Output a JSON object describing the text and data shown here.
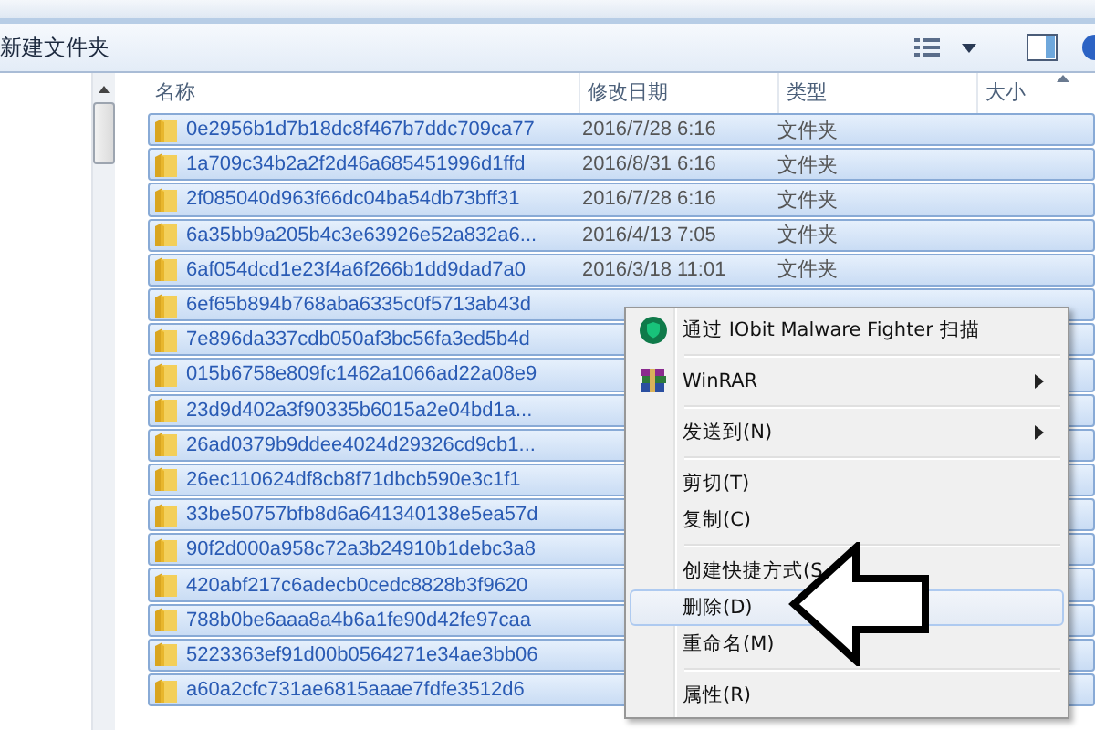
{
  "toolbar": {
    "new_folder": "新建文件夹"
  },
  "columns": [
    "名称",
    "修改日期",
    "类型",
    "大小"
  ],
  "rows": [
    {
      "name": "0e2956b1d7b18dc8f467b7ddc709ca77",
      "date": "2016/7/28 6:16",
      "type": "文件夹",
      "selected": true
    },
    {
      "name": "1a709c34b2a2f2d46a685451996d1ffd",
      "date": "2016/8/31 6:16",
      "type": "文件夹",
      "selected": true
    },
    {
      "name": "2f085040d963f66dc04ba54db73bff31",
      "date": "2016/7/28 6:16",
      "type": "文件夹",
      "selected": true
    },
    {
      "name": "6a35bb9a205b4c3e63926e52a832a6...",
      "date": "2016/4/13 7:05",
      "type": "文件夹",
      "selected": true
    },
    {
      "name": "6af054dcd1e23f4a6f266b1dd9dad7a0",
      "date": "2016/3/18 11:01",
      "type": "文件夹",
      "selected": true
    },
    {
      "name": "6ef65b894b768aba6335c0f5713ab43d",
      "selected": true
    },
    {
      "name": "7e896da337cdb050af3bc56fa3ed5b4d",
      "selected": true
    },
    {
      "name": "015b6758e809fc1462a1066ad22a08e9",
      "selected": true
    },
    {
      "name": "23d9d402a3f90335b6015a2e04bd1a...",
      "selected": true
    },
    {
      "name": "26ad0379b9ddee4024d29326cd9cb1...",
      "selected": true
    },
    {
      "name": "26ec110624df8cb8f71dbcb590e3c1f1",
      "selected": true
    },
    {
      "name": "33be50757bfb8d6a641340138e5ea57d",
      "selected": true
    },
    {
      "name": "90f2d000a958c72a3b24910b1debc3a8",
      "selected": true
    },
    {
      "name": "420abf217c6adecb0cedc8828b3f9620",
      "selected": true
    },
    {
      "name": "788b0be6aaa8a4b6a1fe90d42fe97caa",
      "selected": true
    },
    {
      "name": "5223363ef91d00b0564271e34ae3bb06",
      "selected": true
    },
    {
      "name": "a60a2cfc731ae6815aaae7fdfe3512d6",
      "selected": true
    }
  ],
  "context_menu": [
    {
      "kind": "shield",
      "label": "通过 IObit Malware Fighter 扫描",
      "selected": false
    },
    {
      "kind": "separator"
    },
    {
      "kind": "archive",
      "label": "WinRAR",
      "selected": false
    },
    {
      "kind": "separator"
    },
    {
      "kind": "submenu",
      "label": "发送到(N)",
      "selected": false
    },
    {
      "kind": "separator"
    },
    {
      "kind": "item",
      "label": "剪切(T)",
      "selected": false
    },
    {
      "kind": "item",
      "label": "复制(C)",
      "selected": false
    },
    {
      "kind": "separator"
    },
    {
      "kind": "item",
      "label": "创建快捷方式(S",
      "selected": false
    },
    {
      "kind": "item",
      "label": "删除(D)",
      "selected": true
    },
    {
      "kind": "item",
      "label": "重命名(M)",
      "selected": false
    },
    {
      "kind": "separator"
    },
    {
      "kind": "item",
      "label": "属性(R)",
      "selected": false
    }
  ]
}
